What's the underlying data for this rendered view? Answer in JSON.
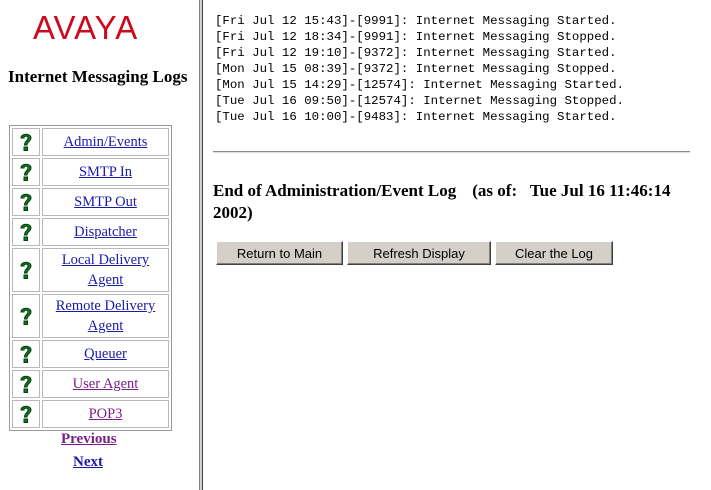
{
  "brand": {
    "logo_text": "AVAYA",
    "logo_color": "#cc0a1e"
  },
  "sidebar": {
    "title": "Internet Messaging Logs",
    "icon": "question-mark-icon",
    "items": [
      {
        "label": "Admin/Events",
        "visited": false
      },
      {
        "label": "SMTP In",
        "visited": false
      },
      {
        "label": "SMTP Out",
        "visited": false
      },
      {
        "label": "Dispatcher",
        "visited": false
      },
      {
        "label": "Local Delivery Agent",
        "visited": false
      },
      {
        "label": "Remote Delivery Agent",
        "visited": false
      },
      {
        "label": "Queuer",
        "visited": false
      },
      {
        "label": "User Agent",
        "visited": true
      },
      {
        "label": "POP3",
        "visited": true
      }
    ],
    "previous_label": "Previous",
    "next_label": "Next"
  },
  "main": {
    "log_lines": [
      "[Fri Jul 12 15:43]-[9991]: Internet Messaging Started.",
      "[Fri Jul 12 18:34]-[9991]: Internet Messaging Stopped.",
      "[Fri Jul 12 19:10]-[9372]: Internet Messaging Started.",
      "[Mon Jul 15 08:39]-[9372]: Internet Messaging Stopped.",
      "[Mon Jul 15 14:29]-[12574]: Internet Messaging Started.",
      "[Tue Jul 16 09:50]-[12574]: Internet Messaging Stopped.",
      "[Tue Jul 16 10:00]-[9483]: Internet Messaging Started."
    ],
    "end_heading": "End of Administration/Event Log",
    "as_of_label": "(as of:",
    "as_of_value": "Tue Jul 16 11:46:14 2002)",
    "buttons": {
      "return_main": "Return to Main",
      "refresh": "Refresh Display",
      "clear": "Clear the Log"
    }
  },
  "colors": {
    "link": "#1a1aa8",
    "visited_link": "#7a1f86",
    "button_face": "#d4d0c8"
  }
}
